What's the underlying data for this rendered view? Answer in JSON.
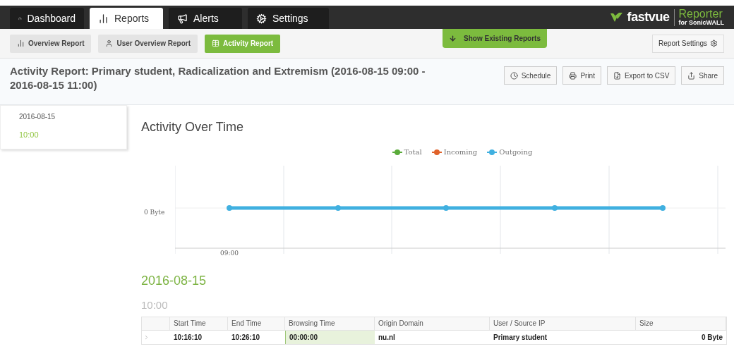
{
  "tabs": [
    {
      "label": "Dashboard",
      "selected": false
    },
    {
      "label": "Reports",
      "selected": true
    },
    {
      "label": "Alerts",
      "selected": false
    },
    {
      "label": "Settings",
      "selected": false
    }
  ],
  "logo": {
    "brand": "fastvue",
    "product": "Reporter",
    "edition": "for SonicWALL"
  },
  "subnav": [
    {
      "label": "Overview Report",
      "selected": false
    },
    {
      "label": "User Overview Report",
      "selected": false
    },
    {
      "label": "Activity Report",
      "selected": true
    }
  ],
  "show_existing": "Show Existing Reports",
  "report_settings": "Report Settings",
  "report_title": "Activity Report: Primary student, Radicalization and Extremism (2016-08-15 09:00 - 2016-08-15 11:00)",
  "actions": [
    {
      "label": "Schedule"
    },
    {
      "label": "Print"
    },
    {
      "label": "Export to CSV"
    },
    {
      "label": "Share"
    }
  ],
  "sidebar": {
    "date": "2016-08-15",
    "time": "10:00"
  },
  "chart": {
    "title": "Activity Over Time",
    "legend": [
      {
        "label": "Total",
        "color": "#5aab3a"
      },
      {
        "label": "Incoming",
        "color": "#e0622a"
      },
      {
        "label": "Outgoing",
        "color": "#40b0e0"
      }
    ],
    "y_label": "0 Byte",
    "x_label": "09:00"
  },
  "section_date": "2016-08-15",
  "section_time": "10:00",
  "table": {
    "columns": [
      "Start Time",
      "End Time",
      "Browsing Time",
      "Origin Domain",
      "User / Source IP",
      "Size"
    ],
    "rows": [
      {
        "cells": [
          "10:16:10",
          "10:26:10",
          "00:00:00",
          "nu.nl",
          "Primary student",
          "0 Byte"
        ],
        "expanded": false
      }
    ]
  }
}
